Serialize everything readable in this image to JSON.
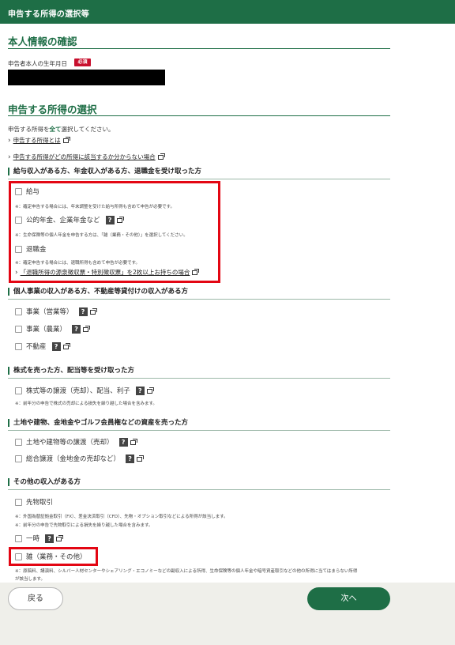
{
  "header": {
    "title": "申告する所得の選択等"
  },
  "personal": {
    "title": "本人情報の確認",
    "dob_label": "申告者本人の生年月日",
    "required_badge": "必須"
  },
  "income_section": {
    "title": "申告する所得の選択",
    "instruction_pre": "申告する所得を",
    "instruction_bold": "全て",
    "instruction_post": "選択してください。",
    "links": [
      "申告する所得とは",
      "申告する所得がどの所得に該当するか分からない場合"
    ]
  },
  "categories": [
    {
      "title": "給与収入がある方、年金収入がある方、退職金を受け取った方",
      "items": [
        {
          "label": "給与",
          "note": "※：確定申告する場合には、年末調整を受けた給与所得も含めて申告が必要です。"
        },
        {
          "label": "公的年金、企業年金など",
          "note": "※：生命保険等の個人年金を申告する方は、「雑（業務・その他）」を選択してください。"
        },
        {
          "label": "退職金",
          "note": "※：確定申告する場合には、退職所得も含めて申告が必要です。"
        }
      ],
      "link": "「退職所得の源泉徴収票・特別徴収票」を2枚以上お持ちの場合"
    },
    {
      "title": "個人事業の収入がある方、不動産等貸付けの収入がある方",
      "items": [
        {
          "label": "事業（営業等）"
        },
        {
          "label": "事業（農業）"
        },
        {
          "label": "不動産"
        }
      ]
    },
    {
      "title": "株式を売った方、配当等を受け取った方",
      "items": [
        {
          "label": "株式等の譲渡（売却）、配当、利子",
          "note": "※：前年分の申告で株式の売却による損失を繰り越した場合を含みます。"
        }
      ]
    },
    {
      "title": "土地や建物、金地金やゴルフ会員権などの資産を売った方",
      "items": [
        {
          "label": "土地や建物等の譲渡（売却）"
        },
        {
          "label": "総合譲渡（金地金の売却など）"
        }
      ]
    },
    {
      "title": "その他の収入がある方",
      "items": [
        {
          "label": "先物取引",
          "note1": "※：外国為替証拠金取引（FX）、差金決済取引（CFD）、先物・オプション取引などによる所得が該当します。",
          "note2": "※：前年分の申告で先物取引による損失を繰り越した場合を含みます。"
        },
        {
          "label": "一時"
        },
        {
          "label": "雑（業務・その他）",
          "note1": "※：原稿料、講演料、シルバー人材センターやシェアリング・エコノミーなどの副収入による所得、生命保険等の個人年金や暗号資産取引などの他の所得に当てはまらない所得",
          "note2": "が該当します。"
        }
      ]
    }
  ],
  "help_icon": "?",
  "footer": {
    "back": "戻る",
    "next": "次へ"
  },
  "colors": {
    "brand_green": "#1e6e46",
    "required_red": "#c8102e",
    "highlight_red": "#e30613"
  }
}
